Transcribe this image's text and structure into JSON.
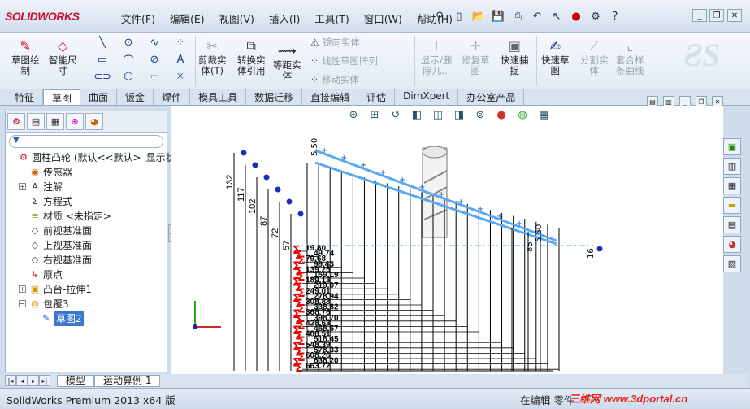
{
  "app": {
    "logo": "SOLIDWORKS"
  },
  "menu": [
    "文件(F)",
    "编辑(E)",
    "视图(V)",
    "插入(I)",
    "工具(T)",
    "窗口(W)",
    "帮助(H)"
  ],
  "ribbon": {
    "sketch_draw": "草图绘\n制",
    "smart_dim": "智能尺\n寸",
    "trim": "剪裁实\n体(T)",
    "convert": "转换实\n体引用",
    "offset": "等距实\n体",
    "mirror": "镜向实体",
    "linear_pattern": "线性草图阵列",
    "move": "移动实体",
    "show_delete": "显示/删\n除几...",
    "repair": "修复草\n图",
    "quick_snap": "快速捕\n捉",
    "rapid_sketch": "快速草\n图",
    "split": "分割实\n体",
    "spline_fit": "套合样\n条曲线"
  },
  "tabs": [
    "特征",
    "草图",
    "曲面",
    "钣金",
    "焊件",
    "模具工具",
    "数据迁移",
    "直接编辑",
    "评估",
    "DimXpert",
    "办公室产品"
  ],
  "active_tab": "草图",
  "tree": {
    "filter": "▼",
    "items": [
      {
        "label": "圆柱凸轮 (默认<<默认>_显示状",
        "icon": "part-icon",
        "indent": 0,
        "expand": ""
      },
      {
        "label": "传感器",
        "icon": "sensor-icon",
        "indent": 1,
        "expand": ""
      },
      {
        "label": "注解",
        "icon": "annotation-icon",
        "indent": 1,
        "expand": "+"
      },
      {
        "label": "方程式",
        "icon": "equation-icon",
        "indent": 1,
        "expand": ""
      },
      {
        "label": "材质 <未指定>",
        "icon": "material-icon",
        "indent": 1,
        "expand": ""
      },
      {
        "label": "前视基准面",
        "icon": "plane-icon",
        "indent": 1,
        "expand": ""
      },
      {
        "label": "上视基准面",
        "icon": "plane-icon",
        "indent": 1,
        "expand": ""
      },
      {
        "label": "右视基准面",
        "icon": "plane-icon",
        "indent": 1,
        "expand": ""
      },
      {
        "label": "原点",
        "icon": "origin-icon",
        "indent": 1,
        "expand": ""
      },
      {
        "label": "凸台-拉伸1",
        "icon": "extrude-icon",
        "indent": 1,
        "expand": "+"
      },
      {
        "label": "包覆3",
        "icon": "wrap-icon",
        "indent": 1,
        "expand": "−"
      },
      {
        "label": "草图2",
        "icon": "sketch-icon",
        "indent": 2,
        "expand": "",
        "selected": true
      }
    ]
  },
  "dimensions": {
    "vertical": [
      "132",
      "117",
      "102",
      "87",
      "72",
      "57"
    ],
    "horizontal": [
      "19.80",
      "49.74",
      "79.68",
      "99.43",
      "139.25",
      "159.19",
      "189.13",
      "219.07",
      "249.01",
      "278.94",
      "308.88",
      "338.82",
      "368.76",
      "398.70",
      "428.63",
      "458.57",
      "488.51",
      "518.45",
      "548.39",
      "578.33",
      "608.26",
      "636.20",
      "663.72"
    ],
    "top": "5.50",
    "end": [
      "85",
      "5.50",
      "16"
    ]
  },
  "bottom_tabs": [
    "模型",
    "运动算例 1"
  ],
  "status": {
    "left": "SolidWorks Premium 2013 x64 版",
    "right": "在编辑 零件"
  },
  "watermark": "三维网 www.3dportal.cn"
}
